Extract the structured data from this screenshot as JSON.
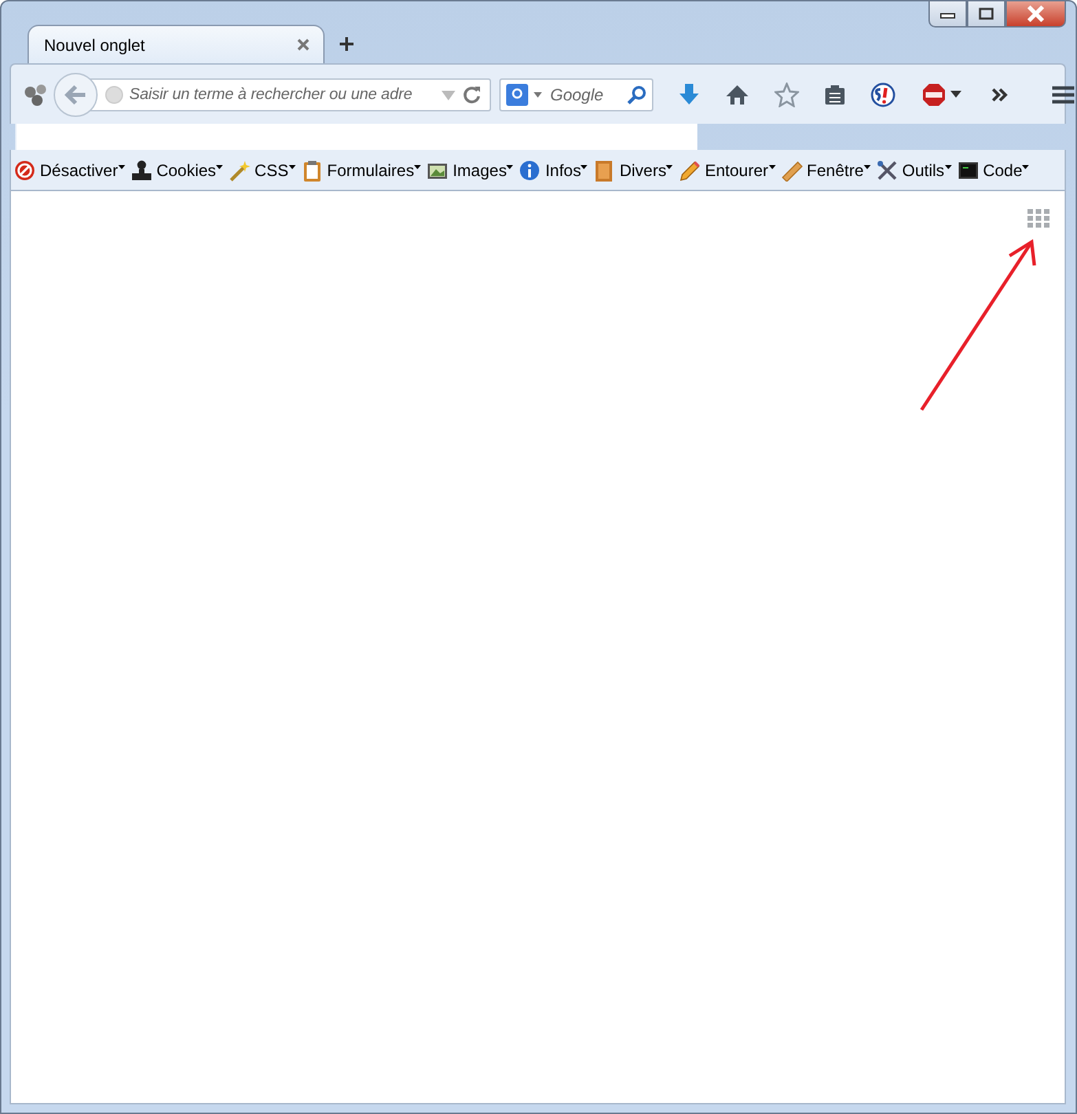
{
  "tab": {
    "title": "Nouvel onglet",
    "selected": true
  },
  "address": {
    "placeholder": "Saisir un terme à rechercher ou une adre"
  },
  "search": {
    "placeholder": "Google"
  },
  "toolbar": [
    {
      "label": "Désactiver"
    },
    {
      "label": "Cookies"
    },
    {
      "label": "CSS"
    },
    {
      "label": "Formulaires"
    },
    {
      "label": "Images"
    },
    {
      "label": "Infos"
    },
    {
      "label": "Divers"
    },
    {
      "label": "Entourer"
    },
    {
      "label": "Fenêtre"
    },
    {
      "label": "Outils"
    },
    {
      "label": "Code"
    }
  ]
}
